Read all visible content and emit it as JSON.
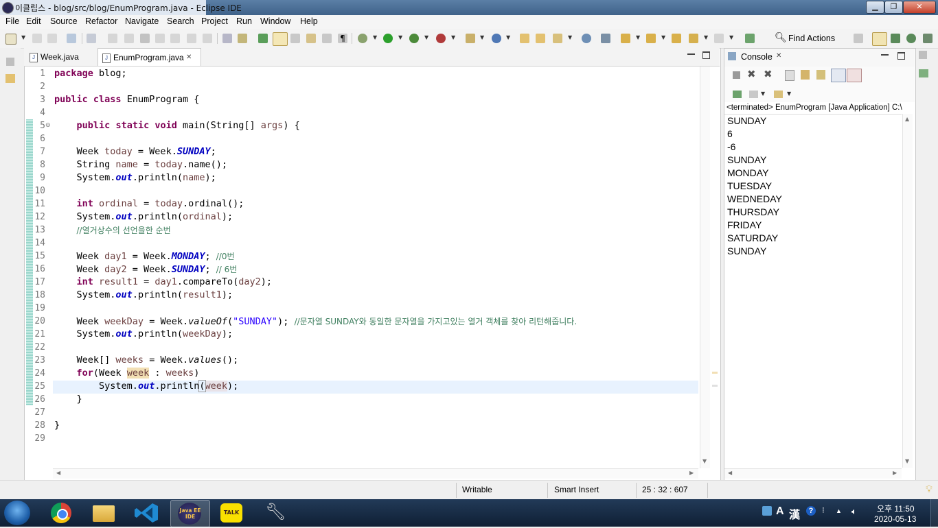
{
  "window": {
    "title": "이클립스 - blog/src/blog/EnumProgram.java - Eclipse IDE",
    "minimize": "▁",
    "maximize": "❐",
    "close": "✕"
  },
  "menu": [
    "File",
    "Edit",
    "Source",
    "Refactor",
    "Navigate",
    "Search",
    "Project",
    "Run",
    "Window",
    "Help"
  ],
  "toolbar": {
    "find_actions": "Find Actions"
  },
  "editor": {
    "tabs": [
      {
        "label": "Week.java",
        "active": false
      },
      {
        "label": "EnumProgram.java",
        "active": true
      }
    ],
    "tab_close": "✕",
    "line_numbers": [
      "1",
      "2",
      "3",
      "4",
      "5",
      "6",
      "7",
      "8",
      "9",
      "10",
      "11",
      "12",
      "13",
      "14",
      "15",
      "16",
      "17",
      "18",
      "19",
      "20",
      "21",
      "22",
      "23",
      "24",
      "25",
      "26",
      "27",
      "28",
      "29"
    ],
    "fold_marker": "⊖"
  },
  "code": {
    "l1": {
      "k": "package",
      "t": " blog;"
    },
    "l3": {
      "k1": "public",
      "k2": "class",
      "t": " EnumProgram {"
    },
    "l5": {
      "k1": "public",
      "k2": "static",
      "k3": "void",
      "t": " main(String[] ",
      "v": "args",
      "e": ") {"
    },
    "l7": {
      "a": "Week ",
      "v": "today",
      "b": " = Week.",
      "f": "SUNDAY",
      "e": ";"
    },
    "l8": {
      "a": "String ",
      "v": "name",
      "b": " = ",
      "v2": "today",
      ".c": ".name();"
    },
    "l9": {
      "a": "System.",
      "f": "out",
      "b": ".println(",
      "v": "name",
      "e": ");"
    },
    "l11": {
      "k": "int",
      "b": " ",
      "v": "ordinal",
      "c": " = ",
      "v2": "today",
      "e": ".ordinal();"
    },
    "l12": {
      "a": "System.",
      "f": "out",
      "b": ".println(",
      "v": "ordinal",
      "e": ");"
    },
    "l13": {
      "c": "//열거상수의 선언을한 순번"
    },
    "l15": {
      "a": "Week ",
      "v": "day1",
      "b": " = Week.",
      "f": "MONDAY",
      "e": "; ",
      "c": "//0번"
    },
    "l16": {
      "a": "Week ",
      "v": "day2",
      "b": " = Week.",
      "f": "SUNDAY",
      "e": "; ",
      "c": "// 6번"
    },
    "l17": {
      "k": "int",
      "b": " ",
      "v": "result1",
      "c": " = ",
      "v2": "day1",
      "d": ".compareTo(",
      "v3": "day2",
      "e": ");"
    },
    "l18": {
      "a": "System.",
      "f": "out",
      "b": ".println(",
      "v": "result1",
      "e": ");"
    },
    "l20": {
      "a": "Week ",
      "v": "weekDay",
      "b": " = Week.",
      "m": "valueOf",
      "s1": "(",
      "s": "\"SUNDAY\"",
      "e": "); ",
      "c": "//문자열 SUNDAY와 동일한 문자열을 가지고있는 열거 객체를 찾아 리턴해줍니다."
    },
    "l21": {
      "a": "System.",
      "f": "out",
      "b": ".println(",
      "v": "weekDay",
      "e": ");"
    },
    "l23": {
      "a": "Week[] ",
      "v": "weeks",
      "b": " = Week.",
      "m": "values",
      "e": "();"
    },
    "l24": {
      "k": "for",
      "a": "(Week ",
      "v": "week",
      "b": " : ",
      "v2": "weeks",
      "e": ")"
    },
    "l25": {
      "a": "System.",
      "f": "out",
      "b": ".println",
      "p": "(",
      "v": "week",
      "e": ");"
    },
    "l26": {
      "t": "}"
    },
    "l28": {
      "t": "}"
    }
  },
  "console": {
    "tab_label": "Console",
    "tab_close": "✕",
    "header": "<terminated> EnumProgram [Java Application] C:\\",
    "lines": [
      "SUNDAY",
      "6",
      "-6",
      "SUNDAY",
      "MONDAY",
      "TUESDAY",
      "WEDNEDAY",
      "THURSDAY",
      "FRIDAY",
      "SATURDAY",
      "SUNDAY"
    ]
  },
  "status": {
    "writable": "Writable",
    "insert_mode": "Smart Insert",
    "position": "25 : 32 : 607"
  },
  "taskbar": {
    "time": "오후 11:50",
    "date": "2020-05-13",
    "ime_a": "A",
    "ime_han": "漢",
    "help": "?",
    "javaee_label": "Java EE IDE",
    "talk_label": "TALK"
  },
  "colors": {
    "keyword": "#7f0055",
    "field": "#0000c0",
    "string": "#2a00ff",
    "comment": "#3f7f5f",
    "variable": "#6a3e3e",
    "current_line": "#e8f2fe",
    "occurrence": "#f2dfb4"
  }
}
